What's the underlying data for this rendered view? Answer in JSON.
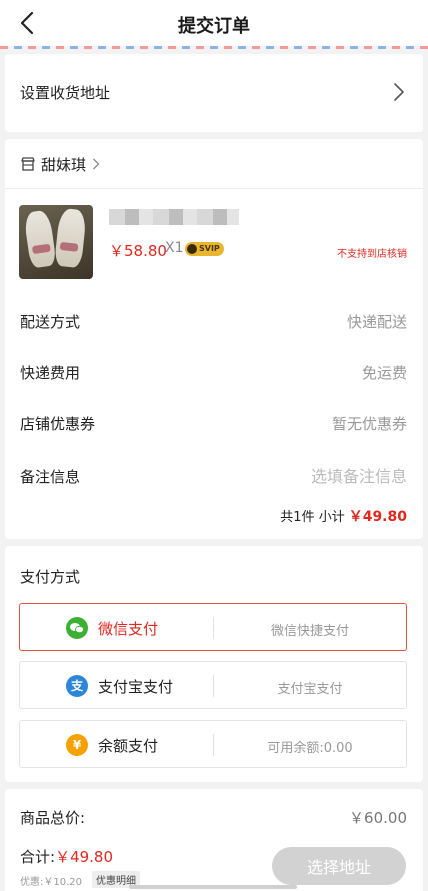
{
  "header": {
    "title": "提交订单"
  },
  "address": {
    "label": "设置收货地址"
  },
  "shop": {
    "name": "甜妹琪"
  },
  "product": {
    "price": "￥58.80",
    "quantity": "X1",
    "badge": "SVIP",
    "pickup_note": "不支持到店核销"
  },
  "order_info": {
    "delivery_label": "配送方式",
    "delivery_value": "快递配送",
    "shipping_label": "快递费用",
    "shipping_value": "免运费",
    "coupon_label": "店铺优惠券",
    "coupon_value": "暂无优惠券",
    "remark_label": "备注信息",
    "remark_placeholder": "选填备注信息",
    "subtotal_prefix": "共1件 小计",
    "subtotal_amount": "￥49.80"
  },
  "payment": {
    "title": "支付方式",
    "options": [
      {
        "name": "微信支付",
        "desc": "微信快捷支付",
        "color": "#3cb034",
        "icon": "wechat-icon",
        "selected": true
      },
      {
        "name": "支付宝支付",
        "desc": "支付宝支付",
        "color": "#2f86d8",
        "icon": "alipay-icon",
        "selected": false
      },
      {
        "name": "余额支付",
        "desc": "可用余额:0.00",
        "color": "#f5a100",
        "icon": "yen-icon",
        "selected": false
      }
    ]
  },
  "summary": {
    "total_label": "商品总价:",
    "total_value": "￥60.00",
    "pay_label": "合计:",
    "pay_value": "￥49.80",
    "discount": "优惠:￥10.20",
    "detail_tag": "优惠明细",
    "button_label": "选择地址"
  },
  "colors": {
    "accent": "#e0281f",
    "button_disabled": "#d2d2d2"
  }
}
